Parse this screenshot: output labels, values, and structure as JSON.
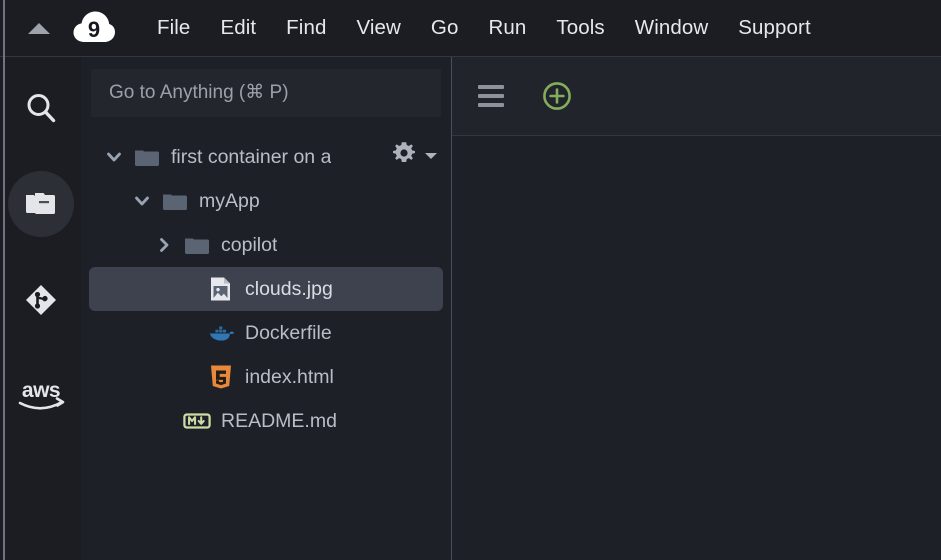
{
  "app": {
    "name": "AWS Cloud9",
    "logo_icon": "cloud9-logo-icon",
    "logo_text": "9"
  },
  "colors": {
    "background": "#1b1d23",
    "panel": "#1e2027",
    "tabbar": "#22242b",
    "selection": "#3d424e",
    "accent_green": "#82ad5d",
    "text": "#e6e8ec",
    "muted_text": "#b8bdc7",
    "folder": "#5a6472",
    "border": "#4a4e58"
  },
  "menubar": {
    "collapse_icon": "triangle-up-icon",
    "items": [
      {
        "label": "File"
      },
      {
        "label": "Edit"
      },
      {
        "label": "Find"
      },
      {
        "label": "View"
      },
      {
        "label": "Go"
      },
      {
        "label": "Run"
      },
      {
        "label": "Tools"
      },
      {
        "label": "Window"
      },
      {
        "label": "Support"
      }
    ]
  },
  "rail": {
    "items": [
      {
        "name": "search",
        "icon": "search-icon",
        "active": false
      },
      {
        "name": "file-explorer",
        "icon": "folder-icon",
        "active": true
      },
      {
        "name": "source-control",
        "icon": "git-icon",
        "active": false
      },
      {
        "name": "aws-toolkit",
        "icon": "aws-logo-icon",
        "active": false
      }
    ]
  },
  "explorer": {
    "search": {
      "placeholder": "Go to Anything (⌘ P)",
      "value": ""
    },
    "settings_icon": "gear-icon",
    "tree": [
      {
        "label": "first container on a",
        "icon": "folder-icon",
        "type": "folder",
        "depth": 0,
        "expanded": true,
        "selected": false,
        "truncated": true
      },
      {
        "label": "myApp",
        "icon": "folder-icon",
        "type": "folder",
        "depth": 1,
        "expanded": true,
        "selected": false
      },
      {
        "label": "copilot",
        "icon": "folder-icon",
        "type": "folder",
        "depth": 2,
        "expanded": false,
        "selected": false
      },
      {
        "label": "clouds.jpg",
        "icon": "image-file-icon",
        "type": "file",
        "depth": 3,
        "selected": true
      },
      {
        "label": "Dockerfile",
        "icon": "docker-whale-icon",
        "type": "file",
        "depth": 3,
        "selected": false
      },
      {
        "label": "index.html",
        "icon": "html5-icon",
        "type": "file",
        "depth": 3,
        "selected": false
      },
      {
        "label": "README.md",
        "icon": "markdown-icon",
        "type": "file",
        "depth": 2,
        "selected": false
      }
    ]
  },
  "editor": {
    "menu_icon": "hamburger-menu-icon",
    "new_tab_icon": "plus-circle-icon",
    "tabs": [],
    "content": ""
  }
}
